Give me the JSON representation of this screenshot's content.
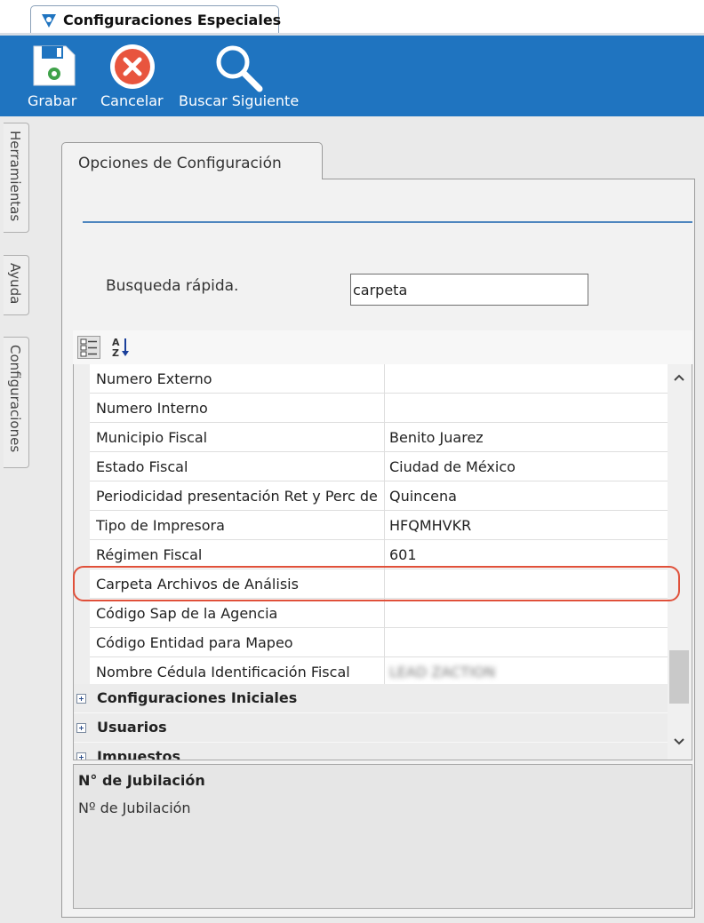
{
  "window_tab": {
    "title": "Configuraciones Especiales"
  },
  "toolbar": {
    "grabar": "Grabar",
    "cancelar": "Cancelar",
    "buscar_siguiente": "Buscar Siguiente"
  },
  "side_tabs": [
    "Herramientas",
    "Ayuda",
    "Configuraciones"
  ],
  "options_tab": {
    "label": "Opciones de Configuración"
  },
  "search": {
    "label": "Busqueda rápida.",
    "value": "carpeta"
  },
  "grid": {
    "rows": [
      {
        "name": "Numero Externo",
        "value": ""
      },
      {
        "name": "Numero Interno",
        "value": ""
      },
      {
        "name": "Municipio Fiscal",
        "value": "Benito Juarez"
      },
      {
        "name": "Estado Fiscal",
        "value": "Ciudad de México"
      },
      {
        "name": "Periodicidad presentación Ret y Perc de",
        "value": "Quincena"
      },
      {
        "name": "Tipo de Impresora",
        "value": "HFQMHVKR"
      },
      {
        "name": "Régimen Fiscal",
        "value": "601"
      },
      {
        "name": "Carpeta Archivos de Análisis",
        "value": ""
      },
      {
        "name": "Código Sap de la Agencia",
        "value": ""
      },
      {
        "name": "Código Entidad para Mapeo",
        "value": ""
      },
      {
        "name": "Nombre Cédula Identificación Fiscal",
        "value": "LEAD ZACTION"
      }
    ],
    "categories": [
      "Configuraciones Iniciales",
      "Usuarios",
      "Impuestos"
    ]
  },
  "description": {
    "title": "N° de Jubilación",
    "text": "Nº de Jubilación"
  },
  "colors": {
    "toolbar": "#1f74c0",
    "highlight": "#e0503a",
    "separator": "#4f86bf"
  }
}
